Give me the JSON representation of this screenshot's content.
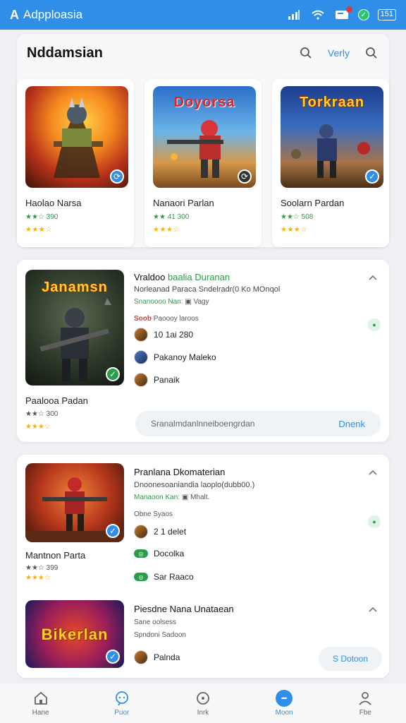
{
  "status_bar": {
    "app_logo": "A",
    "app_name": "Adpploasia",
    "battery": "151"
  },
  "header": {
    "title": "Nddamsian",
    "action_label": "Verly"
  },
  "featured_games": [
    {
      "name": "Haolao Narsa",
      "rating": "★★☆ 390",
      "stars": "★★★☆"
    },
    {
      "name": "Nanaori Parlan",
      "rating": "★★ 41 300",
      "stars": "★★★☆",
      "art_title": "Doyorsa"
    },
    {
      "name": "Soolarn Pardan",
      "rating": "★★☆ 508",
      "stars": "★★★☆",
      "art_title": "Torkraan"
    }
  ],
  "list_card_1": {
    "art_title": "Janamsn",
    "game_name": "Paalooa Padan",
    "rating": "★★☆ 300",
    "stars": "★★★☆",
    "info_title_plain": "Vraldoo ",
    "info_title_highlight": "baalia Duranan",
    "info_line": "Norleanad Paraca Sndelradr(0 Ko MOnqol",
    "info_meta_green": "Snanoooo Nan:",
    "info_meta_rest": "Vagy",
    "info_tags_red": "Soob",
    "info_tags_rest": "Paoooy laroos",
    "people": [
      "10 1ai 280",
      "Pakanoy Maleko",
      "Panaik"
    ],
    "search_placeholder": "Sranalmdanlnneiboengrdan",
    "search_button": "Dnenk"
  },
  "list_card_2": {
    "game_name": "Mantnon Parta",
    "rating": "★★☆ 399",
    "stars": "★★★☆",
    "info_title": "Pranlana Dkomaterian",
    "info_line": "Dnoonesoaniandia laoplo(dubb00.)",
    "info_meta_green": "Manaoon Kan:",
    "info_meta_rest": "Mhalt.",
    "info_sub": "Obne Syaos",
    "people": [
      "2 1 delet",
      "Docolka",
      "Sar Raaco"
    ]
  },
  "list_card_3": {
    "art_title": "Bikerlan",
    "info_title": "Piesdne Nana Unataean",
    "info_line_1": "Sane oolsess",
    "info_line_2": "Spndoni Sadoon",
    "person": "Palnda",
    "button": "S Dotoon"
  },
  "bottom_nav": [
    {
      "label": "Hane"
    },
    {
      "label": "Puor"
    },
    {
      "label": "Inrk"
    },
    {
      "label": "Moon"
    },
    {
      "label": "Fbe"
    }
  ]
}
